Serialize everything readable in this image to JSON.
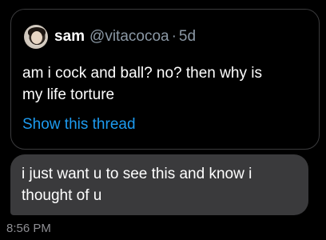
{
  "quoted_tweet": {
    "name": "sam",
    "handle": "@vitacocoa",
    "separator": "·",
    "time_ago": "5d",
    "text_lines": [
      "am i cock and ball? no? then why is",
      "my life torture"
    ],
    "show_thread": "Show this thread",
    "avatar_icon": "profile-photo"
  },
  "message": {
    "text_lines": [
      "i just want u to see this and know i",
      "thought of u"
    ]
  },
  "timestamp": "8:56 PM",
  "colors": {
    "background": "#000000",
    "bubble": "#3a3a3c",
    "link": "#1d9bf0",
    "muted": "#8b98a5"
  }
}
